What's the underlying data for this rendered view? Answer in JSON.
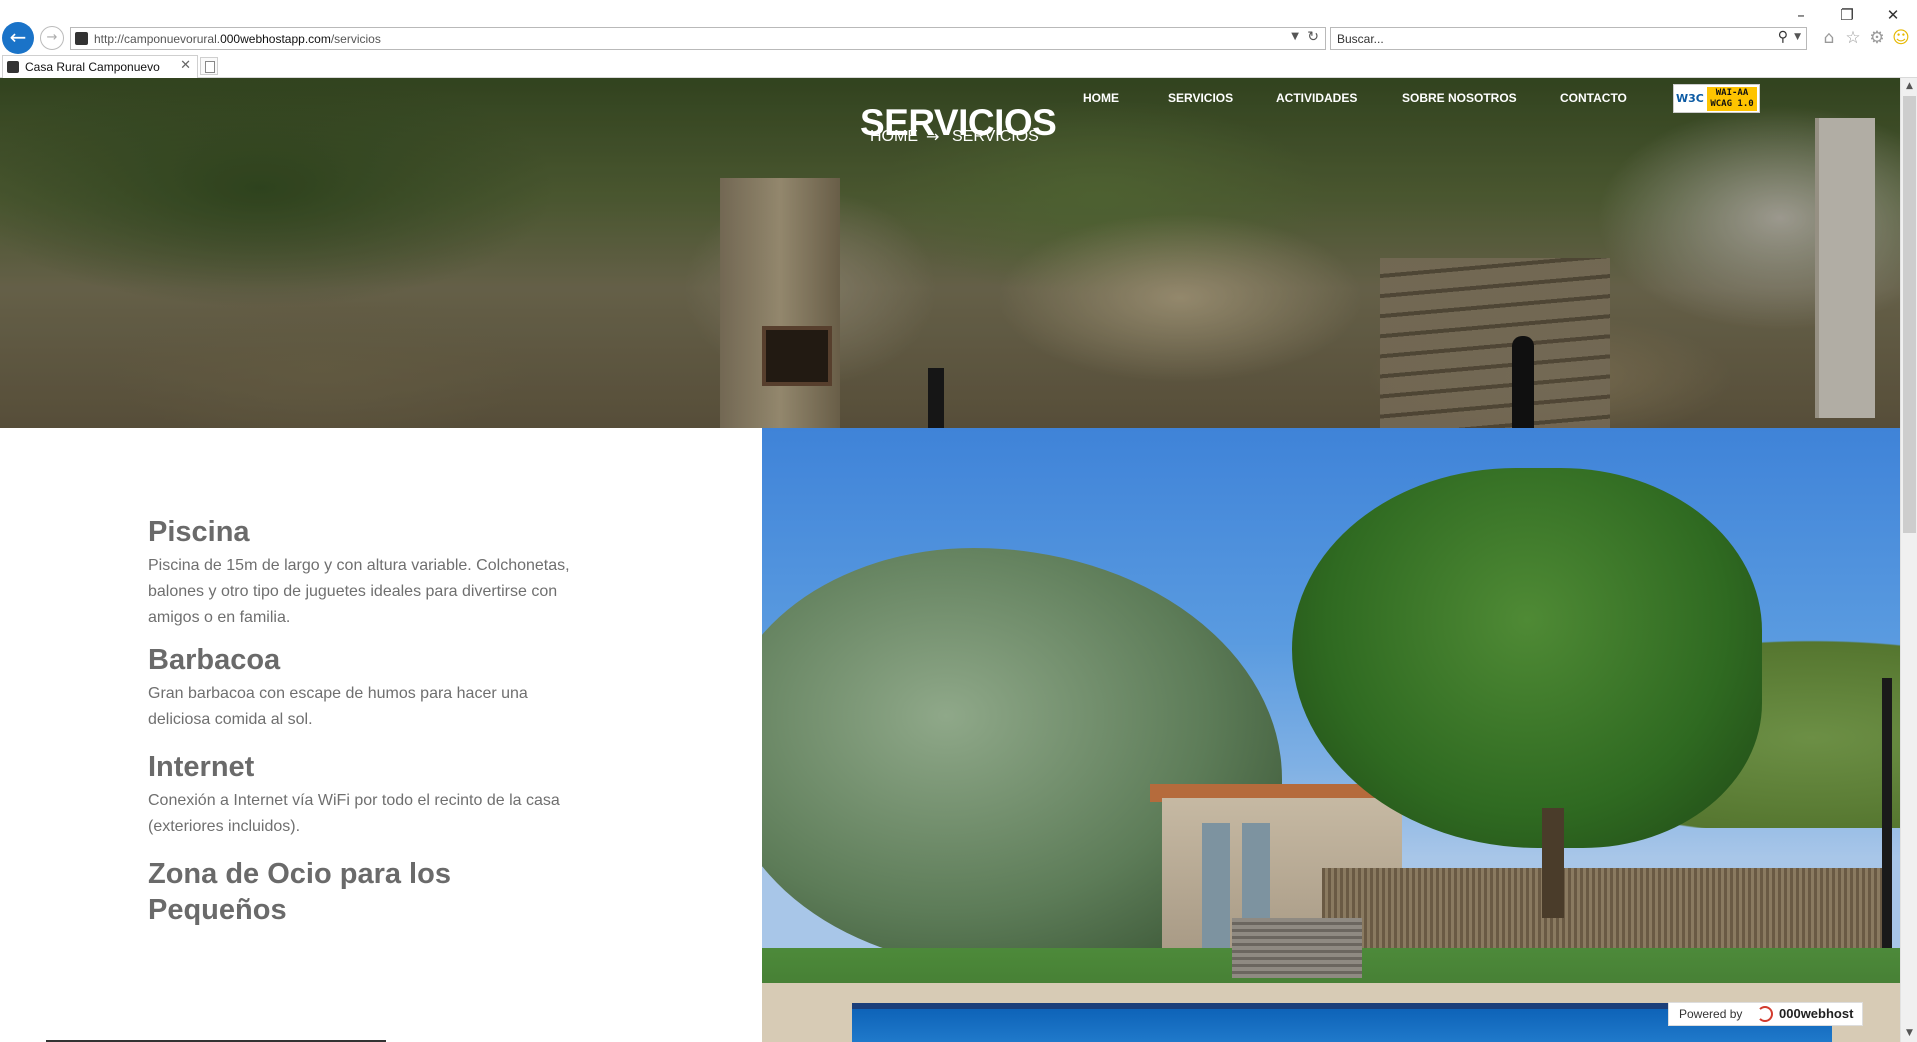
{
  "browser": {
    "url_prefix": "http://camponuevorural.",
    "url_domain": "000webhostapp.com",
    "url_path": "/servicios",
    "search_placeholder": "Buscar...",
    "tab_title": "Casa Rural Camponuevo",
    "icons": {
      "back": "back-arrow-icon",
      "forward": "forward-arrow-icon",
      "refresh": "refresh-icon",
      "search": "search-icon",
      "home": "home-icon",
      "favorites": "star-icon",
      "settings": "gear-icon",
      "feedback": "smiley-icon"
    }
  },
  "hero": {
    "title": "SERVICIOS",
    "breadcrumb": {
      "home": "HOME",
      "current": "SERVICIOS"
    },
    "nav": [
      "HOME",
      "SERVICIOS",
      "ACTIVIDADES",
      "SOBRE NOSOTROS",
      "CONTACTO"
    ],
    "w3c_badge": {
      "logo": "W3C",
      "line1": "WAI-AA",
      "line2": "WCAG 1.0"
    }
  },
  "services": [
    {
      "title": "Piscina",
      "description": "Piscina de 15m de largo y con altura variable. Colchonetas, balones y otro tipo de juguetes ideales para divertirse con amigos o en familia."
    },
    {
      "title": "Barbacoa",
      "description": "Gran barbacoa con escape de humos para hacer una deliciosa comida al sol."
    },
    {
      "title": "Internet",
      "description": "Conexión a Internet vía WiFi por todo el recinto de la casa (exteriores incluidos)."
    },
    {
      "title": "Zona de Ocio para los Pequeños",
      "description": ""
    }
  ],
  "powered": {
    "label": "Powered by",
    "brand": "000webhost"
  },
  "colors": {
    "browser_accent": "#1a73c8",
    "service_title": "#6a6a6a",
    "service_text": "#6f6f6f",
    "badge_yellow": "#fec400"
  }
}
